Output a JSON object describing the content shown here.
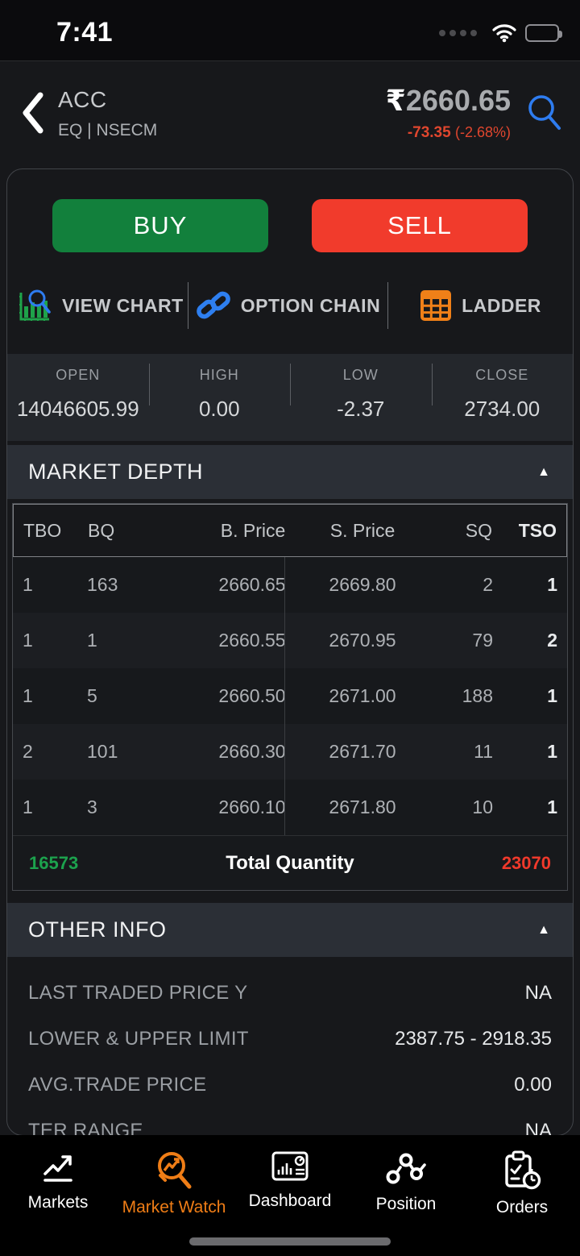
{
  "status_bar": {
    "time": "7:41"
  },
  "header": {
    "symbol": "ACC",
    "segment": "EQ | NSECM",
    "currency": "₹",
    "price": "2660.65",
    "change": "-73.35",
    "change_pct": "(-2.68%)"
  },
  "actions": {
    "buy_label": "BUY",
    "sell_label": "SELL",
    "view_chart_label": "VIEW CHART",
    "option_chain_label": "OPTION CHAIN",
    "ladder_label": "LADDER"
  },
  "ohlc": {
    "items": [
      {
        "label": "OPEN",
        "value": "14046605.99"
      },
      {
        "label": "HIGH",
        "value": "0.00"
      },
      {
        "label": "LOW",
        "value": "-2.37"
      },
      {
        "label": "CLOSE",
        "value": "2734.00"
      }
    ]
  },
  "market_depth": {
    "title": "MARKET DEPTH",
    "columns": [
      "TBO",
      "BQ",
      "B. Price",
      "S. Price",
      "SQ",
      "TSO"
    ],
    "rows": [
      [
        "1",
        "163",
        "2660.65",
        "2669.80",
        "2",
        "1"
      ],
      [
        "1",
        "1",
        "2660.55",
        "2670.95",
        "79",
        "2"
      ],
      [
        "1",
        "5",
        "2660.50",
        "2671.00",
        "188",
        "1"
      ],
      [
        "2",
        "101",
        "2660.30",
        "2671.70",
        "11",
        "1"
      ],
      [
        "1",
        "3",
        "2660.10",
        "2671.80",
        "10",
        "1"
      ]
    ],
    "total_label": "Total Quantity",
    "total_buy_qty": "16573",
    "total_sell_qty": "23070"
  },
  "other_info": {
    "title": "OTHER INFO",
    "rows": [
      {
        "label": "LAST TRADED PRICE Y",
        "value": "NA"
      },
      {
        "label": "LOWER & UPPER LIMIT",
        "value": "2387.75 - 2918.35"
      },
      {
        "label": "AVG.TRADE PRICE",
        "value": "0.00"
      },
      {
        "label": "TER RANGE",
        "value": "NA"
      }
    ]
  },
  "nav": {
    "items": [
      {
        "label": "Markets"
      },
      {
        "label": "Market Watch"
      },
      {
        "label": "Dashboard"
      },
      {
        "label": "Position"
      },
      {
        "label": "Orders"
      }
    ],
    "active": "Market Watch"
  },
  "icons": {
    "caret_up": "▲"
  },
  "colors": {
    "buy_green": "#12803c",
    "sell_red": "#f13b2c",
    "link_blue": "#2e7cf0",
    "accent_orange": "#ef7d16",
    "positive_green": "#1ca24d",
    "negative_red": "#f0392b",
    "change_red": "#e0462e"
  }
}
